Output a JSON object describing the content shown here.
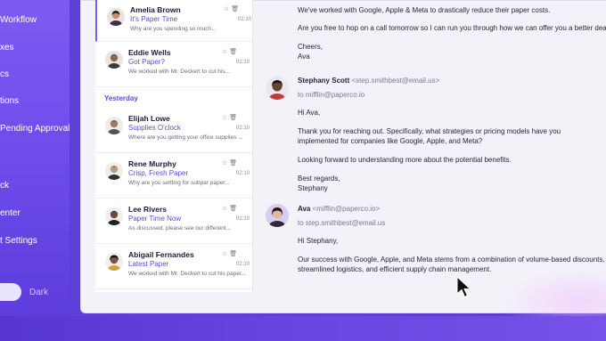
{
  "sidebar": {
    "items": [
      {
        "label": "Workflow"
      },
      {
        "label": "xes"
      },
      {
        "label": "cs"
      },
      {
        "label": "tions"
      },
      {
        "label": "Pending Approval"
      },
      {
        "label": "ck"
      },
      {
        "label": "enter"
      },
      {
        "label": "t Settings"
      }
    ],
    "theme_toggle": {
      "label": "Dark"
    }
  },
  "mail_list": {
    "day_header": "Yesterday",
    "items": [
      {
        "name": "Amelia Brown",
        "subject": "It's Paper Time",
        "preview": "Why are you spending so much...",
        "time": "02:10",
        "avatar_color": "#c98b6a",
        "active": true
      },
      {
        "name": "Eddie Wells",
        "subject": "Got Paper?",
        "preview": "We worked with Mr. Deckert to cut his...",
        "time": "02:10",
        "avatar_color": "#8a6a55"
      },
      {
        "name": "Elijah Lowe",
        "subject": "Supplies O'clock",
        "preview": "Where are you getting your office supplies ...",
        "time": "02:10",
        "avatar_color": "#9a7b68"
      },
      {
        "name": "Rene Murphy",
        "subject": "Crisp, Fresh Paper",
        "preview": "Why are you settling for subpar paper...",
        "time": "02:10",
        "avatar_color": "#b99a84"
      },
      {
        "name": "Lee Rivers",
        "subject": "Paper Time Now",
        "preview": "As discussed, please see our different...",
        "time": "02:10",
        "avatar_color": "#6e4a38"
      },
      {
        "name": "Abigail Fernandes",
        "subject": "Latest Paper",
        "preview": "We worked with Mr. Deckert to cut his paper...",
        "time": "02:10",
        "avatar_color": "#7a5440"
      }
    ]
  },
  "reading_pane": {
    "prev_lines": [
      "We've worked with Google, Apple & Meta to drastically reduce their paper costs.",
      "Are you free to hop on a call tomorrow so I can run you through how we can offer you a better deal?",
      "Cheers,",
      "Ava"
    ],
    "message1": {
      "sender_name": "Stephany Scott",
      "sender_email": "<step.smithbest@email.us>",
      "to": "to mifflin@paperco.io",
      "greeting": "Hi Ava,",
      "body_lines": [
        "Thank you for reaching out. Specifically, what strategies or pricing models have you",
        "implemented for companies like Google, Apple, and Meta?",
        "Looking forward to understanding more about the potential benefits.",
        "Best regards,",
        "Stephany"
      ]
    },
    "message2": {
      "sender_name": "Ava",
      "sender_email": "<mifflin@paperco.io>",
      "to": "to step.smithbest@email.us",
      "greeting": "Hi Stephany,",
      "body_lines": [
        "Our success with Google, Apple, and Meta stems from a combination of volume-based discounts,",
        "streamlined logistics, and efficient supply chain management."
      ]
    }
  },
  "colors": {
    "accent": "#6a49ea",
    "subject": "#5a4fd0"
  }
}
